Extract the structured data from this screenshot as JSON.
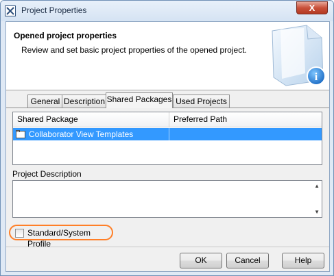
{
  "window": {
    "title": "Project Properties",
    "close_glyph": "X"
  },
  "header": {
    "title": "Opened project properties",
    "subtitle": "Review and set basic project properties of the opened project.",
    "illustration_icon": "document-info-icon"
  },
  "tabs": [
    {
      "label": "General",
      "active": false
    },
    {
      "label": "Description",
      "active": false
    },
    {
      "label": "Shared Packages",
      "active": true
    },
    {
      "label": "Used Projects",
      "active": false
    }
  ],
  "table": {
    "columns": [
      "Shared Package",
      "Preferred Path"
    ],
    "rows": [
      {
        "package": "Collaborator View Templates",
        "path": "",
        "selected": true
      }
    ]
  },
  "description": {
    "label": "Project Description",
    "value": ""
  },
  "profile": {
    "label": "Standard/System Profile",
    "checked": false
  },
  "buttons": {
    "ok": "OK",
    "cancel": "Cancel",
    "help": "Help"
  },
  "colors": {
    "selection": "#3399ff",
    "highlight": "#ff7f27",
    "close": "#c9503a"
  }
}
